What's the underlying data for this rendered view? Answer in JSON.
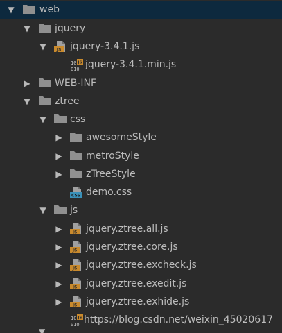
{
  "tree": {
    "items": [
      {
        "label": "web",
        "type": "folder",
        "expanded": true,
        "selected": true
      },
      {
        "label": "jquery",
        "type": "folder",
        "expanded": true
      },
      {
        "label": "jquery-3.4.1.js",
        "type": "js-file",
        "expanded": true
      },
      {
        "label": "jquery-3.4.1.min.js",
        "type": "min-js-file"
      },
      {
        "label": "WEB-INF",
        "type": "folder",
        "expanded": false
      },
      {
        "label": "ztree",
        "type": "folder",
        "expanded": true
      },
      {
        "label": "css",
        "type": "folder",
        "expanded": true
      },
      {
        "label": "awesomeStyle",
        "type": "folder",
        "expanded": false
      },
      {
        "label": "metroStyle",
        "type": "folder",
        "expanded": false
      },
      {
        "label": "zTreeStyle",
        "type": "folder",
        "expanded": false
      },
      {
        "label": "demo.css",
        "type": "css-file"
      },
      {
        "label": "js",
        "type": "folder",
        "expanded": true
      },
      {
        "label": "jquery.ztree.all.js",
        "type": "js-file",
        "expanded": false
      },
      {
        "label": "jquery.ztree.core.js",
        "type": "js-file",
        "expanded": false
      },
      {
        "label": "jquery.ztree.excheck.js",
        "type": "js-file",
        "expanded": false
      },
      {
        "label": "jquery.ztree.exedit.js",
        "type": "js-file",
        "expanded": false
      },
      {
        "label": "jquery.ztree.exhide.js",
        "type": "js-file",
        "expanded": false
      }
    ]
  },
  "watermark": "https://blog.csdn.net/weixin_45020617",
  "icons": {
    "folder": "folder-icon",
    "js_file": "js-file-icon",
    "min_js_file": "minified-js-file-icon",
    "css_file": "css-file-icon",
    "expanded": "chevron-down-icon",
    "collapsed": "chevron-right-icon"
  },
  "colors": {
    "background": "#2b2b2b",
    "selection": "#0d293e",
    "text": "#bbbbbb",
    "folder": "#909090",
    "js_badge": "#c98a2d",
    "css_badge": "#3a90b8"
  }
}
